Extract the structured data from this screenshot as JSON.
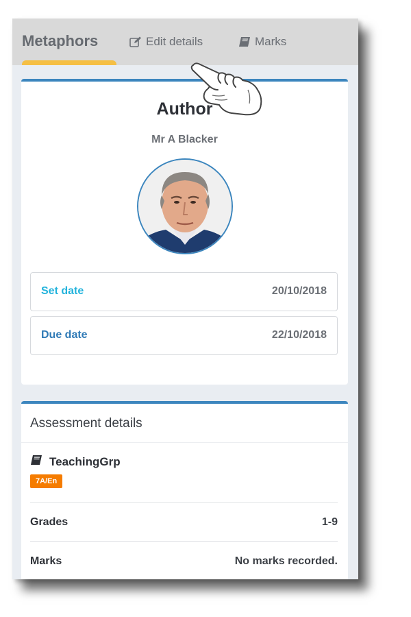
{
  "tabs": {
    "title": "Metaphors",
    "edit_label": "Edit details",
    "marks_label": "Marks"
  },
  "author": {
    "heading": "Author",
    "name": "Mr A Blacker"
  },
  "dates": {
    "set_label": "Set date",
    "set_value": "20/10/2018",
    "due_label": "Due date",
    "due_value": "22/10/2018"
  },
  "assessment": {
    "heading": "Assessment details",
    "group_label": "TeachingGrp",
    "group_badge": "7A/En",
    "grades_label": "Grades",
    "grades_value": "1-9",
    "marks_label": "Marks",
    "marks_value": "No marks recorded."
  },
  "colors": {
    "accent_blue": "#3c86be",
    "tab_underline": "#f5bf45",
    "set_date_color": "#22b3dc",
    "due_date_color": "#2f7ab6",
    "badge_orange": "#f57c00"
  },
  "icons": {
    "edit": "edit-icon",
    "marks": "book-icon",
    "group": "book-icon",
    "pointer": "pointing-hand-icon"
  }
}
